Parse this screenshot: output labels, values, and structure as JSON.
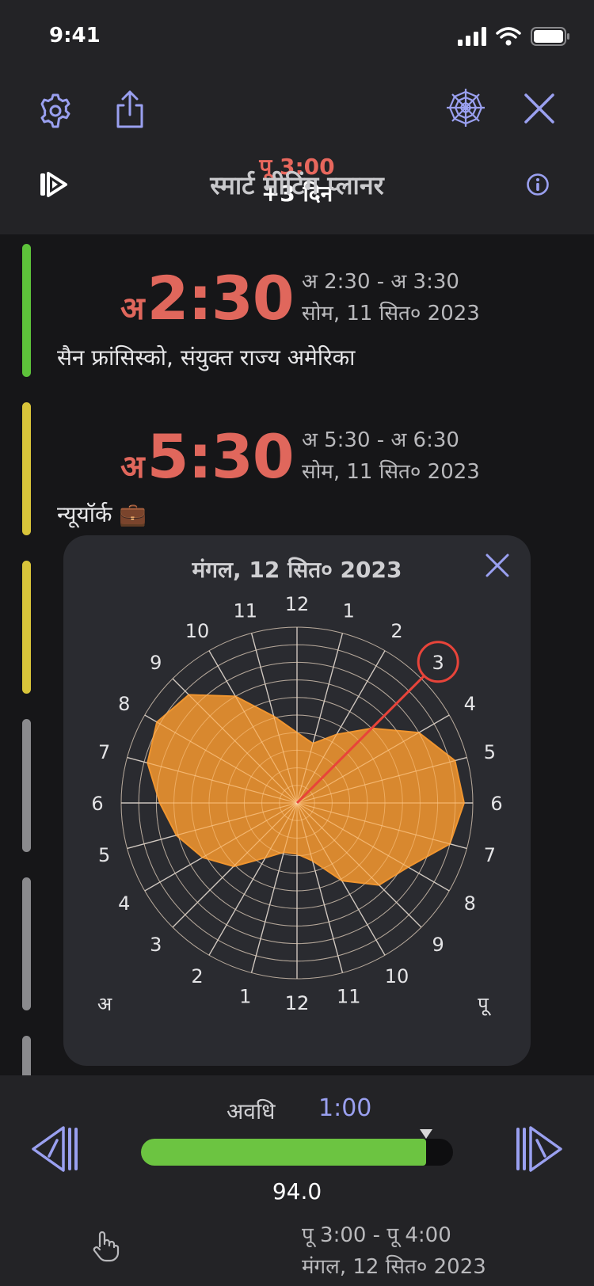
{
  "status": {
    "time": "9:41"
  },
  "header": {
    "selected_time": "पू 3:00",
    "day_offset": "+3 दिन",
    "title": "स्मार्ट मीटिंग प्लानर"
  },
  "icons": {
    "settings": "gear-icon",
    "share": "share-icon",
    "chart": "spiderweb-icon",
    "close": "close-icon",
    "play": "play-forward-icon",
    "info": "info-icon",
    "prev": "step-back-icon",
    "next": "step-forward-icon",
    "hand": "hand-pointer-icon"
  },
  "rows": [
    {
      "prefix": "अ",
      "time": "2:30",
      "range": "अ 2:30 - अ 3:30",
      "date": "सोम, 11 सित० 2023",
      "city": "सैन फ्रांसिस्को, संयुक्त राज्य अमेरिका",
      "color": "#5dc23a"
    },
    {
      "prefix": "अ",
      "time": "5:30",
      "range": "अ 5:30 - अ 6:30",
      "date": "सोम, 11 सित० 2023",
      "city": "न्यूयॉर्क 💼",
      "color": "#d8c43a"
    }
  ],
  "popup": {
    "date": "मंगल, 12 सित० 2023",
    "am_label": "अ",
    "pm_label": "पू"
  },
  "chart_data": {
    "type": "radar",
    "center_hours_label": "12",
    "right_hours": [
      "1",
      "2",
      "3",
      "4",
      "5",
      "6",
      "7",
      "8",
      "9",
      "10",
      "11",
      "12"
    ],
    "left_hours": [
      "11",
      "10",
      "9",
      "8",
      "7",
      "6",
      "5",
      "4",
      "3",
      "2",
      "1",
      "12"
    ],
    "ring_count": 10,
    "values": [
      4,
      3.5,
      4.5,
      6,
      8,
      9.3,
      9.5,
      9,
      7.3,
      6.6,
      5.1,
      3.4,
      2.9,
      2.9,
      3.6,
      5.1,
      6.2,
      7.1,
      7.8,
      8.8,
      9.2,
      8.7,
      7,
      5.1
    ],
    "highlight_label": "3",
    "highlight_hour_index": 3
  },
  "bottom": {
    "duration_label": "अवधि",
    "duration_value": "1:00",
    "slider_value": "94.0",
    "slider_fraction": 0.94,
    "peek_range": "पू 3:00 - पू 4:00",
    "peek_date": "मंगल, 12 सित० 2023"
  },
  "colors": {
    "accent": "#9aa0f0",
    "time_red": "#e0675c",
    "radar_fill": "#f0952f",
    "highlight": "#e8443a",
    "green": "#6cc441"
  }
}
